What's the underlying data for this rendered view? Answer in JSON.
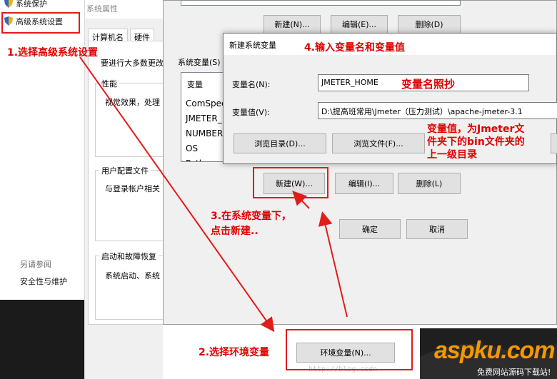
{
  "left_panel": {
    "item_system_protection": "系统保护",
    "item_advanced_settings": "高级系统设置",
    "see_also": "另请参阅",
    "security_maintenance": "安全性与维护"
  },
  "system_properties": {
    "title": "系统属性",
    "tabs": [
      "计算机名",
      "硬件"
    ],
    "intro": "要进行大多数更改",
    "performance_title": "性能",
    "performance_text": "视觉效果，处理",
    "profile_title": "用户配置文件",
    "profile_text": "与登录帐户相关",
    "startup_title": "启动和故障恢复",
    "startup_text": "系统启动、系统",
    "env_button": "环境变量(N)..."
  },
  "env_dialog": {
    "user_buttons": {
      "new": "新建(N)...",
      "edit": "编辑(E)...",
      "delete": "删除(D)"
    },
    "system_vars_label": "系统变量(S)",
    "list_header": "变量",
    "list_items": [
      "ComSpec",
      "JMETER_",
      "NUMBER_",
      "OS",
      "Path"
    ],
    "sys_buttons": {
      "new": "新建(W)...",
      "edit": "编辑(I)...",
      "delete": "删除(L)"
    },
    "ok": "确定",
    "cancel": "取消"
  },
  "new_var_dialog": {
    "title": "新建系统变量",
    "name_label": "变量名(N):",
    "name_value": "JMETER_HOME",
    "value_label": "变量值(V):",
    "value_value": "D:\\提高班常用\\Jmeter（压力测试）\\apache-jmeter-3.1",
    "browse_dir": "浏览目录(D)...",
    "browse_file": "浏览文件(F)..."
  },
  "annotations": {
    "step1": "1.选择高级系统设置",
    "step2": "2.选择环境变量",
    "step3_line1": "3.在系统变量下，",
    "step3_line2": "点击新建..",
    "step4": "4.输入变量名和变量值",
    "name_note": "变量名照抄",
    "value_note_line1": "变量值，为Jmeter文",
    "value_note_line2": "件夹下的bin文件夹的",
    "value_note_line3": "上一级目录"
  },
  "watermark": {
    "brand": "aspku.com",
    "sub": "免费网站源码下载站!",
    "url": "http://blog.csdn"
  },
  "colors": {
    "annotation_red": "#e00000",
    "brand_orange": "#f39800"
  }
}
